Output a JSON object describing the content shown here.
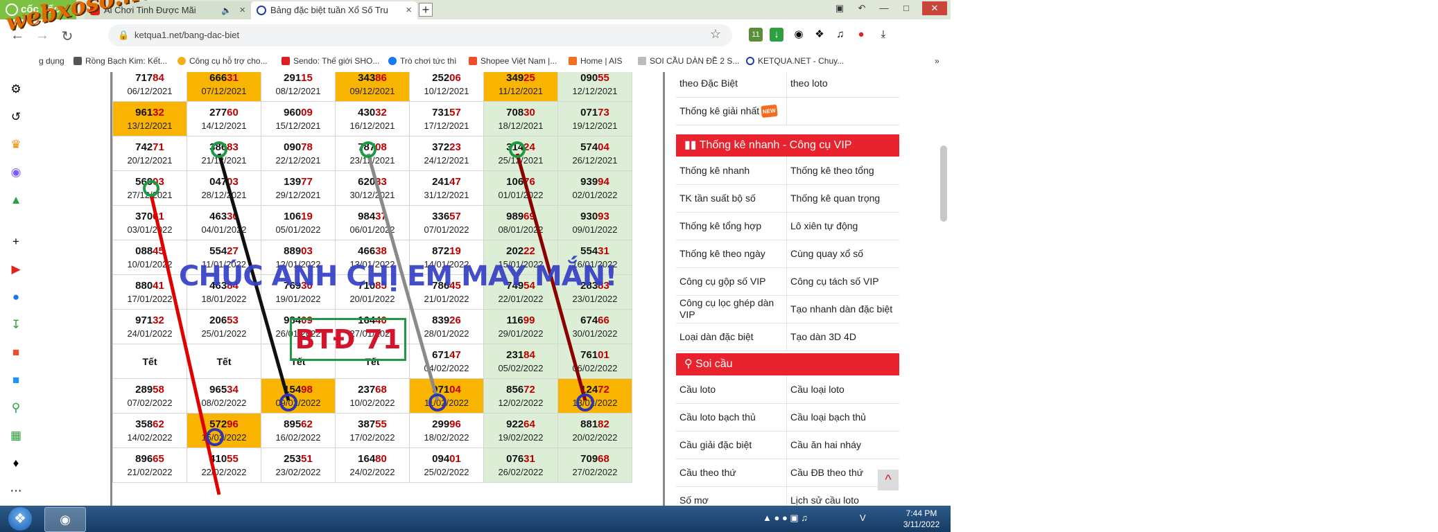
{
  "browser": {
    "brand": "cốc cốc",
    "tabs": [
      {
        "title": "Ai Chơi Tinh Được Mãi",
        "icon": "youtube-icon"
      },
      {
        "title": "Bảng đặc biệt tuần Xổ Số Tru",
        "icon": "ketqua-icon"
      }
    ],
    "new_tab_label": "+",
    "url": "ketqua1.net/bang-dac-biet",
    "bookmarks": [
      "g dụng",
      "Rồng Bạch Kim: Kết...",
      "Công cụ hỗ trợ cho...",
      "Sendo: Thế giới SHO...",
      "Trò chơi tức thì",
      "Shopee Việt Nam |...",
      "Home | AIS",
      "SOI CẦU DÀN ĐỀ 2 S...",
      "KETQUA.NET - Chuy..."
    ],
    "bookmark_more": "»",
    "extension_badge": "11",
    "watermark": "webxoso.net"
  },
  "table": {
    "rows": [
      [
        {
          "p": "717",
          "s": "84",
          "d": "06/12/2021"
        },
        {
          "p": "666",
          "s": "31",
          "d": "07/12/2021",
          "hl": true
        },
        {
          "p": "291",
          "s": "15",
          "d": "08/12/2021"
        },
        {
          "p": "343",
          "s": "86",
          "d": "09/12/2021",
          "hl": true
        },
        {
          "p": "252",
          "s": "06",
          "d": "10/12/2021"
        },
        {
          "p": "349",
          "s": "25",
          "d": "11/12/2021",
          "hl": true
        },
        {
          "p": "090",
          "s": "55",
          "d": "12/12/2021",
          "gr": true
        }
      ],
      [
        {
          "p": "961",
          "s": "32",
          "d": "13/12/2021",
          "hl": true
        },
        {
          "p": "277",
          "s": "60",
          "d": "14/12/2021"
        },
        {
          "p": "960",
          "s": "09",
          "d": "15/12/2021"
        },
        {
          "p": "430",
          "s": "32",
          "d": "16/12/2021"
        },
        {
          "p": "731",
          "s": "57",
          "d": "17/12/2021"
        },
        {
          "p": "708",
          "s": "30",
          "d": "18/12/2021",
          "gr": true
        },
        {
          "p": "071",
          "s": "73",
          "d": "19/12/2021",
          "gr": true
        }
      ],
      [
        {
          "p": "742",
          "s": "71",
          "d": "20/12/2021"
        },
        {
          "p": "386",
          "s": "83",
          "d": "21/12/2021"
        },
        {
          "p": "090",
          "s": "78",
          "d": "22/12/2021"
        },
        {
          "p": "787",
          "s": "08",
          "d": "23/12/2021"
        },
        {
          "p": "372",
          "s": "23",
          "d": "24/12/2021"
        },
        {
          "p": "314",
          "s": "24",
          "d": "25/12/2021",
          "gr": true
        },
        {
          "p": "574",
          "s": "04",
          "d": "26/12/2021",
          "gr": true
        }
      ],
      [
        {
          "p": "569",
          "s": "03",
          "d": "27/12/2021"
        },
        {
          "p": "047",
          "s": "03",
          "d": "28/12/2021"
        },
        {
          "p": "139",
          "s": "77",
          "d": "29/12/2021"
        },
        {
          "p": "620",
          "s": "33",
          "d": "30/12/2021"
        },
        {
          "p": "241",
          "s": "47",
          "d": "31/12/2021"
        },
        {
          "p": "106",
          "s": "76",
          "d": "01/01/2022",
          "gr": true
        },
        {
          "p": "939",
          "s": "94",
          "d": "02/01/2022",
          "gr": true
        }
      ],
      [
        {
          "p": "370",
          "s": "61",
          "d": "03/01/2022"
        },
        {
          "p": "463",
          "s": "30",
          "d": "04/01/2022"
        },
        {
          "p": "106",
          "s": "19",
          "d": "05/01/2022"
        },
        {
          "p": "984",
          "s": "37",
          "d": "06/01/2022"
        },
        {
          "p": "336",
          "s": "57",
          "d": "07/01/2022"
        },
        {
          "p": "989",
          "s": "69",
          "d": "08/01/2022",
          "gr": true
        },
        {
          "p": "930",
          "s": "93",
          "d": "09/01/2022",
          "gr": true
        }
      ],
      [
        {
          "p": "088",
          "s": "45",
          "d": "10/01/2022"
        },
        {
          "p": "554",
          "s": "27",
          "d": "11/01/2022"
        },
        {
          "p": "889",
          "s": "03",
          "d": "12/01/2022"
        },
        {
          "p": "466",
          "s": "38",
          "d": "13/01/2022"
        },
        {
          "p": "872",
          "s": "19",
          "d": "14/01/2022"
        },
        {
          "p": "202",
          "s": "22",
          "d": "15/01/2022",
          "gr": true
        },
        {
          "p": "554",
          "s": "31",
          "d": "16/01/2022",
          "gr": true
        }
      ],
      [
        {
          "p": "880",
          "s": "41",
          "d": "17/01/2022"
        },
        {
          "p": "463",
          "s": "84",
          "d": "18/01/2022"
        },
        {
          "p": "769",
          "s": "30",
          "d": "19/01/2022"
        },
        {
          "p": "710",
          "s": "85",
          "d": "20/01/2022"
        },
        {
          "p": "786",
          "s": "45",
          "d": "21/01/2022"
        },
        {
          "p": "749",
          "s": "54",
          "d": "22/01/2022",
          "gr": true
        },
        {
          "p": "283",
          "s": "83",
          "d": "23/01/2022",
          "gr": true
        }
      ],
      [
        {
          "p": "971",
          "s": "32",
          "d": "24/01/2022"
        },
        {
          "p": "206",
          "s": "53",
          "d": "25/01/2022"
        },
        {
          "p": "984",
          "s": "09",
          "d": "26/01/2022"
        },
        {
          "p": "164",
          "s": "40",
          "d": "27/01/2022"
        },
        {
          "p": "839",
          "s": "26",
          "d": "28/01/2022"
        },
        {
          "p": "116",
          "s": "99",
          "d": "29/01/2022",
          "gr": true
        },
        {
          "p": "674",
          "s": "66",
          "d": "30/01/2022",
          "gr": true
        }
      ],
      [
        {
          "p": "Tết",
          "s": "",
          "d": ""
        },
        {
          "p": "Tết",
          "s": "",
          "d": ""
        },
        {
          "p": "Tết",
          "s": "",
          "d": ""
        },
        {
          "p": "Tết",
          "s": "",
          "d": ""
        },
        {
          "p": "671",
          "s": "47",
          "d": "04/02/2022"
        },
        {
          "p": "231",
          "s": "84",
          "d": "05/02/2022",
          "gr": true
        },
        {
          "p": "761",
          "s": "01",
          "d": "06/02/2022",
          "gr": true
        }
      ],
      [
        {
          "p": "289",
          "s": "58",
          "d": "07/02/2022"
        },
        {
          "p": "965",
          "s": "34",
          "d": "08/02/2022"
        },
        {
          "p": "154",
          "s": "98",
          "d": "09/02/2022",
          "hl": true
        },
        {
          "p": "237",
          "s": "68",
          "d": "10/02/2022"
        },
        {
          "p": "971",
          "s": "04",
          "d": "11/02/2022",
          "hl": true
        },
        {
          "p": "856",
          "s": "72",
          "d": "12/02/2022",
          "gr": true
        },
        {
          "p": "124",
          "s": "72",
          "d": "13/02/2022",
          "hl": true
        }
      ],
      [
        {
          "p": "358",
          "s": "62",
          "d": "14/02/2022"
        },
        {
          "p": "572",
          "s": "96",
          "d": "15/02/2022",
          "hl": true
        },
        {
          "p": "895",
          "s": "62",
          "d": "16/02/2022"
        },
        {
          "p": "387",
          "s": "55",
          "d": "17/02/2022"
        },
        {
          "p": "299",
          "s": "96",
          "d": "18/02/2022"
        },
        {
          "p": "922",
          "s": "64",
          "d": "19/02/2022",
          "gr": true
        },
        {
          "p": "881",
          "s": "82",
          "d": "20/02/2022",
          "gr": true
        }
      ],
      [
        {
          "p": "896",
          "s": "65",
          "d": "21/02/2022"
        },
        {
          "p": "410",
          "s": "55",
          "d": "22/02/2022"
        },
        {
          "p": "253",
          "s": "51",
          "d": "23/02/2022"
        },
        {
          "p": "164",
          "s": "80",
          "d": "24/02/2022"
        },
        {
          "p": "094",
          "s": "01",
          "d": "25/02/2022"
        },
        {
          "p": "076",
          "s": "31",
          "d": "26/02/2022",
          "gr": true
        },
        {
          "p": "709",
          "s": "68",
          "d": "27/02/2022",
          "gr": true
        }
      ]
    ],
    "overlay_message": "CHÚC ANH CHỊ EM MAY MẮN!",
    "overlay_box": "BTĐ 71"
  },
  "right_panel": {
    "top_rows": [
      [
        "theo Đặc Biệt",
        "theo loto"
      ],
      [
        "Thống kê giải nhất",
        ""
      ]
    ],
    "new_badge": "NEW",
    "section1_title": "Thống kê nhanh - Công cụ VIP",
    "section1_rows": [
      [
        "Thống kê nhanh",
        "Thống kê theo tổng"
      ],
      [
        "TK tần suất bộ số",
        "Thống kê quan trọng"
      ],
      [
        "Thống kê tổng hợp",
        "Lô xiên tự động"
      ],
      [
        "Thống kê theo ngày",
        "Cùng quay xổ số"
      ],
      [
        "Công cụ gộp số VIP",
        "Công cụ tách số VIP"
      ],
      [
        "Công cụ lọc ghép dàn VIP",
        "Tạo nhanh dàn đặc biệt"
      ],
      [
        "Loại dàn đặc biệt",
        "Tạo dàn 3D 4D"
      ]
    ],
    "section2_title": "Soi cầu",
    "section2_rows": [
      [
        "Cầu loto",
        "Cầu loại loto"
      ],
      [
        "Cầu loto bạch thủ",
        "Cầu loại bạch thủ"
      ],
      [
        "Cầu giải đặc biệt",
        "Cầu ăn hai nháy"
      ],
      [
        "Cầu theo thứ",
        "Cầu ĐB theo thứ"
      ],
      [
        "Số mơ",
        "Lịch sử cầu loto"
      ]
    ],
    "to_top": "^"
  },
  "taskbar": {
    "time": "7:44 PM",
    "date": "3/11/2022"
  }
}
